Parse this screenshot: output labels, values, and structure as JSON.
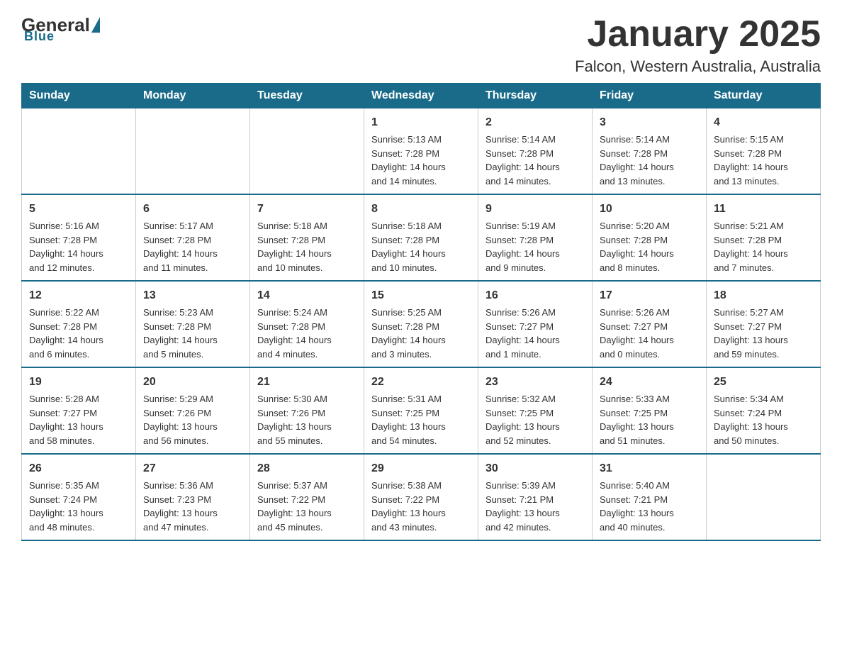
{
  "logo": {
    "general": "General",
    "blue": "Blue",
    "underline": "Blue"
  },
  "header": {
    "title": "January 2025",
    "subtitle": "Falcon, Western Australia, Australia"
  },
  "weekdays": [
    "Sunday",
    "Monday",
    "Tuesday",
    "Wednesday",
    "Thursday",
    "Friday",
    "Saturday"
  ],
  "weeks": [
    [
      {
        "day": "",
        "info": ""
      },
      {
        "day": "",
        "info": ""
      },
      {
        "day": "",
        "info": ""
      },
      {
        "day": "1",
        "info": "Sunrise: 5:13 AM\nSunset: 7:28 PM\nDaylight: 14 hours\nand 14 minutes."
      },
      {
        "day": "2",
        "info": "Sunrise: 5:14 AM\nSunset: 7:28 PM\nDaylight: 14 hours\nand 14 minutes."
      },
      {
        "day": "3",
        "info": "Sunrise: 5:14 AM\nSunset: 7:28 PM\nDaylight: 14 hours\nand 13 minutes."
      },
      {
        "day": "4",
        "info": "Sunrise: 5:15 AM\nSunset: 7:28 PM\nDaylight: 14 hours\nand 13 minutes."
      }
    ],
    [
      {
        "day": "5",
        "info": "Sunrise: 5:16 AM\nSunset: 7:28 PM\nDaylight: 14 hours\nand 12 minutes."
      },
      {
        "day": "6",
        "info": "Sunrise: 5:17 AM\nSunset: 7:28 PM\nDaylight: 14 hours\nand 11 minutes."
      },
      {
        "day": "7",
        "info": "Sunrise: 5:18 AM\nSunset: 7:28 PM\nDaylight: 14 hours\nand 10 minutes."
      },
      {
        "day": "8",
        "info": "Sunrise: 5:18 AM\nSunset: 7:28 PM\nDaylight: 14 hours\nand 10 minutes."
      },
      {
        "day": "9",
        "info": "Sunrise: 5:19 AM\nSunset: 7:28 PM\nDaylight: 14 hours\nand 9 minutes."
      },
      {
        "day": "10",
        "info": "Sunrise: 5:20 AM\nSunset: 7:28 PM\nDaylight: 14 hours\nand 8 minutes."
      },
      {
        "day": "11",
        "info": "Sunrise: 5:21 AM\nSunset: 7:28 PM\nDaylight: 14 hours\nand 7 minutes."
      }
    ],
    [
      {
        "day": "12",
        "info": "Sunrise: 5:22 AM\nSunset: 7:28 PM\nDaylight: 14 hours\nand 6 minutes."
      },
      {
        "day": "13",
        "info": "Sunrise: 5:23 AM\nSunset: 7:28 PM\nDaylight: 14 hours\nand 5 minutes."
      },
      {
        "day": "14",
        "info": "Sunrise: 5:24 AM\nSunset: 7:28 PM\nDaylight: 14 hours\nand 4 minutes."
      },
      {
        "day": "15",
        "info": "Sunrise: 5:25 AM\nSunset: 7:28 PM\nDaylight: 14 hours\nand 3 minutes."
      },
      {
        "day": "16",
        "info": "Sunrise: 5:26 AM\nSunset: 7:27 PM\nDaylight: 14 hours\nand 1 minute."
      },
      {
        "day": "17",
        "info": "Sunrise: 5:26 AM\nSunset: 7:27 PM\nDaylight: 14 hours\nand 0 minutes."
      },
      {
        "day": "18",
        "info": "Sunrise: 5:27 AM\nSunset: 7:27 PM\nDaylight: 13 hours\nand 59 minutes."
      }
    ],
    [
      {
        "day": "19",
        "info": "Sunrise: 5:28 AM\nSunset: 7:27 PM\nDaylight: 13 hours\nand 58 minutes."
      },
      {
        "day": "20",
        "info": "Sunrise: 5:29 AM\nSunset: 7:26 PM\nDaylight: 13 hours\nand 56 minutes."
      },
      {
        "day": "21",
        "info": "Sunrise: 5:30 AM\nSunset: 7:26 PM\nDaylight: 13 hours\nand 55 minutes."
      },
      {
        "day": "22",
        "info": "Sunrise: 5:31 AM\nSunset: 7:25 PM\nDaylight: 13 hours\nand 54 minutes."
      },
      {
        "day": "23",
        "info": "Sunrise: 5:32 AM\nSunset: 7:25 PM\nDaylight: 13 hours\nand 52 minutes."
      },
      {
        "day": "24",
        "info": "Sunrise: 5:33 AM\nSunset: 7:25 PM\nDaylight: 13 hours\nand 51 minutes."
      },
      {
        "day": "25",
        "info": "Sunrise: 5:34 AM\nSunset: 7:24 PM\nDaylight: 13 hours\nand 50 minutes."
      }
    ],
    [
      {
        "day": "26",
        "info": "Sunrise: 5:35 AM\nSunset: 7:24 PM\nDaylight: 13 hours\nand 48 minutes."
      },
      {
        "day": "27",
        "info": "Sunrise: 5:36 AM\nSunset: 7:23 PM\nDaylight: 13 hours\nand 47 minutes."
      },
      {
        "day": "28",
        "info": "Sunrise: 5:37 AM\nSunset: 7:22 PM\nDaylight: 13 hours\nand 45 minutes."
      },
      {
        "day": "29",
        "info": "Sunrise: 5:38 AM\nSunset: 7:22 PM\nDaylight: 13 hours\nand 43 minutes."
      },
      {
        "day": "30",
        "info": "Sunrise: 5:39 AM\nSunset: 7:21 PM\nDaylight: 13 hours\nand 42 minutes."
      },
      {
        "day": "31",
        "info": "Sunrise: 5:40 AM\nSunset: 7:21 PM\nDaylight: 13 hours\nand 40 minutes."
      },
      {
        "day": "",
        "info": ""
      }
    ]
  ]
}
